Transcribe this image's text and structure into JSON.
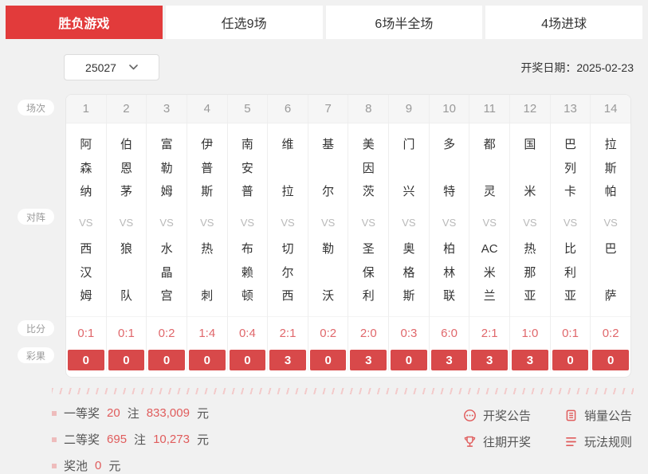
{
  "tabs": [
    {
      "id": "shengfu",
      "label": "胜负游戏",
      "active": true
    },
    {
      "id": "renxuan9",
      "label": "任选9场",
      "active": false
    },
    {
      "id": "banquan6",
      "label": "6场半全场",
      "active": false
    },
    {
      "id": "jinqiu4",
      "label": "4场进球",
      "active": false
    }
  ],
  "toolbar": {
    "issue_select": "25027",
    "draw_date": "开奖日期：2025-02-23"
  },
  "table": {
    "row_labels": {
      "session": "场次",
      "matchup": "对阵",
      "score": "比分",
      "result": "彩果"
    },
    "vs_label": "VS",
    "matches": [
      {
        "no": "1",
        "home": [
          "阿",
          "森",
          "纳"
        ],
        "away": [
          "西",
          "汉",
          "姆"
        ],
        "score": "0:1",
        "result": "0"
      },
      {
        "no": "2",
        "home": [
          "伯",
          "恩",
          "茅"
        ],
        "away": [
          "狼",
          "队"
        ],
        "score": "0:1",
        "result": "0"
      },
      {
        "no": "3",
        "home": [
          "富",
          "勒",
          "姆"
        ],
        "away": [
          "水",
          "晶",
          "宫"
        ],
        "score": "0:2",
        "result": "0"
      },
      {
        "no": "4",
        "home": [
          "伊",
          "普",
          "斯"
        ],
        "away": [
          "热",
          "刺"
        ],
        "score": "1:4",
        "result": "0"
      },
      {
        "no": "5",
        "home": [
          "南",
          "安",
          "普"
        ],
        "away": [
          "布",
          "赖",
          "顿"
        ],
        "score": "0:4",
        "result": "0"
      },
      {
        "no": "6",
        "home": [
          "维",
          "拉"
        ],
        "away": [
          "切",
          "尔",
          "西"
        ],
        "score": "2:1",
        "result": "3"
      },
      {
        "no": "7",
        "home": [
          "基",
          "尔"
        ],
        "away": [
          "勒",
          "沃"
        ],
        "score": "0:2",
        "result": "0"
      },
      {
        "no": "8",
        "home": [
          "美",
          "因",
          "茨"
        ],
        "away": [
          "圣",
          "保",
          "利"
        ],
        "score": "2:0",
        "result": "3"
      },
      {
        "no": "9",
        "home": [
          "门",
          "兴"
        ],
        "away": [
          "奥",
          "格",
          "斯"
        ],
        "score": "0:3",
        "result": "0"
      },
      {
        "no": "10",
        "home": [
          "多",
          "特"
        ],
        "away": [
          "柏",
          "林",
          "联"
        ],
        "score": "6:0",
        "result": "3"
      },
      {
        "no": "11",
        "home": [
          "都",
          "灵"
        ],
        "away": [
          "AC",
          "米",
          "兰"
        ],
        "score": "2:1",
        "result": "3"
      },
      {
        "no": "12",
        "home": [
          "国",
          "米"
        ],
        "away": [
          "热",
          "那",
          "亚"
        ],
        "score": "1:0",
        "result": "3"
      },
      {
        "no": "13",
        "home": [
          "巴",
          "列",
          "卡"
        ],
        "away": [
          "比",
          "利",
          "亚"
        ],
        "score": "0:1",
        "result": "0"
      },
      {
        "no": "14",
        "home": [
          "拉",
          "斯",
          "帕"
        ],
        "away": [
          "巴",
          "萨"
        ],
        "score": "0:2",
        "result": "0"
      }
    ]
  },
  "summary": {
    "items": [
      {
        "label": "一等奖",
        "count": "20",
        "unit1": "注",
        "amount": "833,009",
        "unit2": "元"
      },
      {
        "label": "二等奖",
        "count": "695",
        "unit1": "注",
        "amount": "10,273",
        "unit2": "元"
      },
      {
        "label": "奖池",
        "count": "0",
        "unit1": "元",
        "amount": null,
        "unit2": null
      }
    ]
  },
  "links": [
    {
      "label": "开奖公告",
      "icon": "ellipsis-bubble-icon"
    },
    {
      "label": "销量公告",
      "icon": "document-icon"
    },
    {
      "label": "往期开奖",
      "icon": "trophy-icon"
    },
    {
      "label": "玩法规则",
      "icon": "list-lines-icon"
    }
  ],
  "colors": {
    "accent_red": "#e23b3b",
    "result_band_red": "#d8494a",
    "score_red": "#e0676b",
    "icon_red": "#e05c5c",
    "page_bg": "#f1f1f1"
  }
}
